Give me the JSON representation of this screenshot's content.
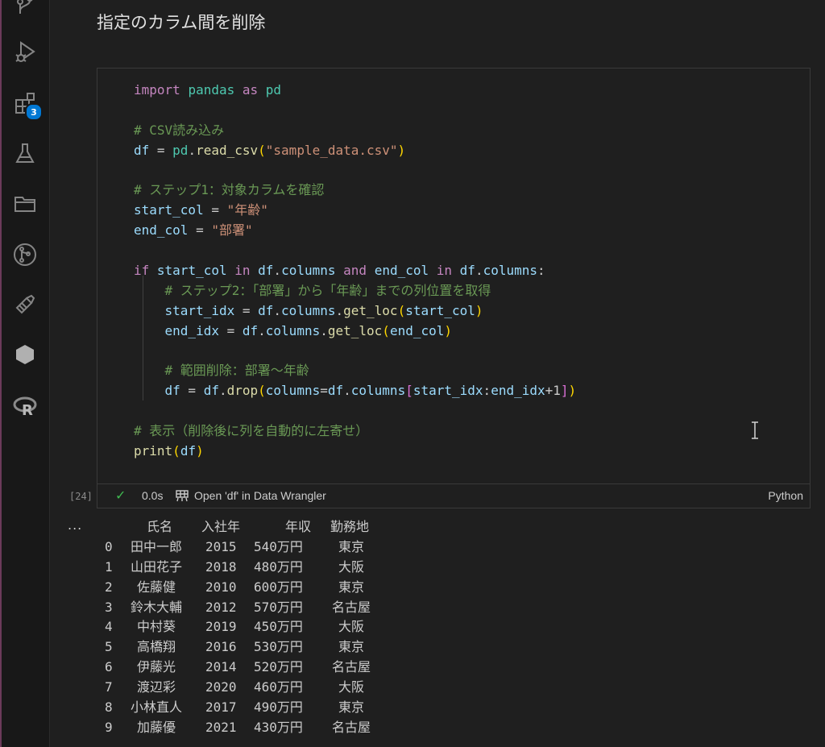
{
  "activity_bar": {
    "icons": [
      "source-control-icon",
      "run-debug-icon",
      "extensions-icon",
      "testing-flask-icon",
      "remote-explorer-icon",
      "git-graph-icon",
      "dev-containers-icon",
      "hexagon-icon",
      "r-language-icon"
    ],
    "extensions_badge": "3"
  },
  "notebook": {
    "markdown_title": "指定のカラム間を削除",
    "cell": {
      "execution_count": "[24]",
      "exec_time": "0.0s",
      "wrangler_label": "Open 'df' in Data Wrangler",
      "language": "Python"
    },
    "code_lines": [
      "import pandas as pd",
      "",
      "# CSV読み込み",
      "df = pd.read_csv(\"sample_data.csv\")",
      "",
      "# ステップ1：対象カラムを確認",
      "start_col = \"年齢\"",
      "end_col = \"部署\"",
      "",
      "if start_col in df.columns and end_col in df.columns:",
      "    # ステップ2：「部署」から「年齢」までの列位置を取得",
      "    start_idx = df.columns.get_loc(start_col)",
      "    end_idx = df.columns.get_loc(end_col)",
      "",
      "    # 範囲削除：部署〜年齢",
      "    df = df.drop(columns=df.columns[start_idx:end_idx+1])",
      "",
      "# 表示（削除後に列を自動的に左寄せ）",
      "print(df)"
    ],
    "output": {
      "menu_glyph": "...",
      "headers": [
        "氏名",
        "入社年",
        "年収",
        "勤務地"
      ],
      "rows": [
        [
          "0",
          "田中一郎",
          "2015",
          "540万円",
          "東京"
        ],
        [
          "1",
          "山田花子",
          "2018",
          "480万円",
          "大阪"
        ],
        [
          "2",
          "佐藤健",
          "2010",
          "600万円",
          "東京"
        ],
        [
          "3",
          "鈴木大輔",
          "2012",
          "570万円",
          "名古屋"
        ],
        [
          "4",
          "中村葵",
          "2019",
          "450万円",
          "大阪"
        ],
        [
          "5",
          "高橋翔",
          "2016",
          "530万円",
          "東京"
        ],
        [
          "6",
          "伊藤光",
          "2014",
          "520万円",
          "名古屋"
        ],
        [
          "7",
          "渡辺彩",
          "2020",
          "460万円",
          "大阪"
        ],
        [
          "8",
          "小林直人",
          "2017",
          "490万円",
          "東京"
        ],
        [
          "9",
          "加藤優",
          "2021",
          "430万円",
          "名古屋"
        ]
      ]
    }
  }
}
